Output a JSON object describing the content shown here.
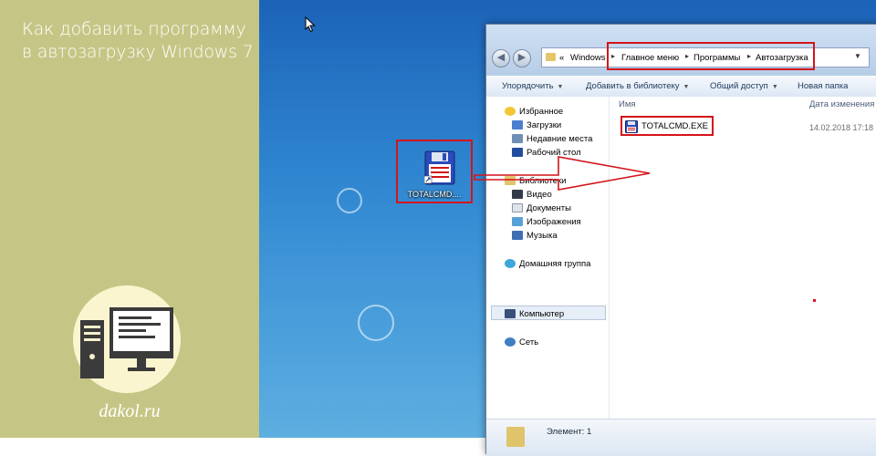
{
  "left_panel": {
    "title_line1": "Как добавить программу",
    "title_line2": "в автозагрузку Windows 7",
    "site": "dakol.ru",
    "logo_icon": "computer-monitor-icon"
  },
  "desktop": {
    "icon_label": "TOTALCMD....",
    "icon": "floppy-disk-icon"
  },
  "explorer": {
    "address": {
      "prefix": "«",
      "crumbs": [
        "Windows",
        "Главное меню",
        "Программы",
        "Автозагрузка"
      ]
    },
    "toolbar": {
      "organize": "Упорядочить",
      "add_to_library": "Добавить в библиотеку",
      "share": "Общий доступ",
      "new_folder": "Новая папка"
    },
    "nav": {
      "favorites": "Избранное",
      "downloads": "Загрузки",
      "recent": "Недавние места",
      "desktop": "Рабочий стол",
      "libraries": "Библиотеки",
      "video": "Видео",
      "documents": "Документы",
      "images": "Изображения",
      "music": "Музыка",
      "homegroup": "Домашняя группа",
      "computer": "Компьютер",
      "network": "Сеть"
    },
    "columns": {
      "name": "Имя",
      "date": "Дата изменения"
    },
    "files": [
      {
        "name": "TOTALCMD.EXE",
        "date": "14.02.2018 17:18"
      }
    ],
    "status": "Элемент: 1"
  },
  "colors": {
    "highlight": "#d3141b",
    "left_panel_bg": "#c5c685",
    "logo_bg": "#fbf5cf"
  }
}
